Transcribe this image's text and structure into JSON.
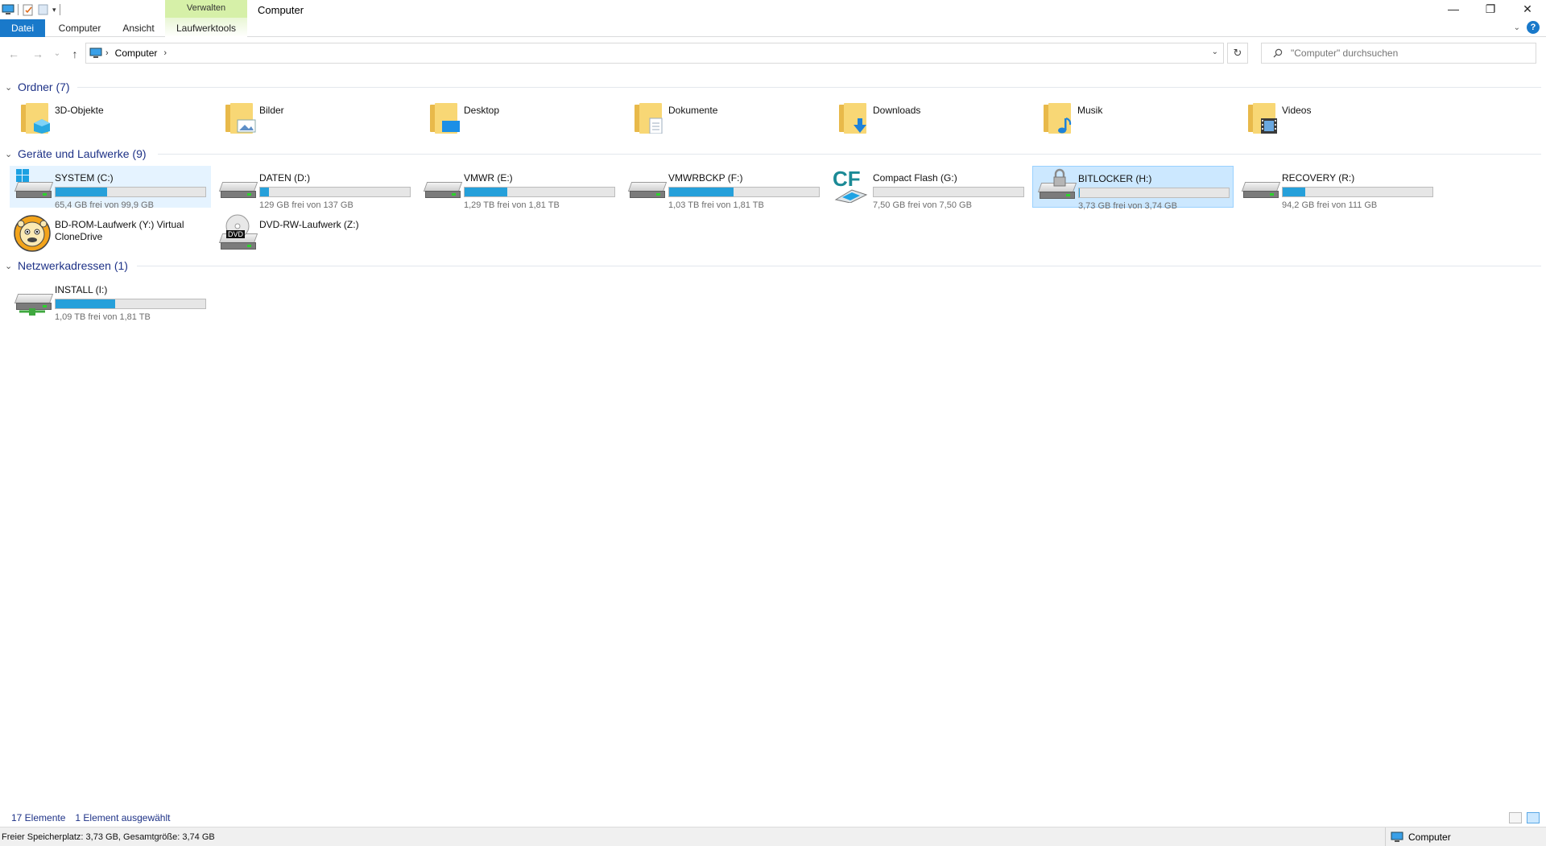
{
  "window": {
    "title": "Computer",
    "context_group": "Verwalten",
    "controls": {
      "minimize": "—",
      "maximize": "❐",
      "close": "✕"
    }
  },
  "ribbon": {
    "tabs": [
      "Datei",
      "Computer",
      "Ansicht"
    ],
    "context_tab": "Laufwerktools",
    "help": "?"
  },
  "nav": {
    "back": "←",
    "forward": "→",
    "recent": "⌄",
    "up": "↑",
    "breadcrumb": [
      "Computer"
    ],
    "search_placeholder": "\"Computer\" durchsuchen"
  },
  "groups": {
    "folders": {
      "label": "Ordner (7)"
    },
    "drives": {
      "label": "Geräte und Laufwerke (9)"
    },
    "network": {
      "label": "Netzwerkadressen (1)"
    }
  },
  "folders": [
    {
      "name": "3D-Objekte",
      "icon": "3d-objects-icon",
      "badge_color": "#29a8e0"
    },
    {
      "name": "Bilder",
      "icon": "pictures-icon",
      "badge_color": "#5e8fc7"
    },
    {
      "name": "Desktop",
      "icon": "desktop-icon",
      "badge_color": "#1c8fe6"
    },
    {
      "name": "Dokumente",
      "icon": "documents-icon",
      "badge_color": "#9dadbf"
    },
    {
      "name": "Downloads",
      "icon": "downloads-icon",
      "badge_color": "#1d82d9"
    },
    {
      "name": "Musik",
      "icon": "music-icon",
      "badge_color": "#1d82d9"
    },
    {
      "name": "Videos",
      "icon": "videos-icon",
      "badge_color": "#3a3a3a"
    }
  ],
  "drives": [
    {
      "name": "SYSTEM (C:)",
      "free": "65,4 GB frei von 99,9 GB",
      "used_fraction": 0.345,
      "icon": "windows-drive-icon"
    },
    {
      "name": "DATEN (D:)",
      "free": "129 GB frei von 137 GB",
      "used_fraction": 0.058,
      "icon": "hard-drive-icon"
    },
    {
      "name": "VMWR (E:)",
      "free": "1,29 TB frei von 1,81 TB",
      "used_fraction": 0.287,
      "icon": "hard-drive-icon"
    },
    {
      "name": "VMWRBCKP (F:)",
      "free": "1,03 TB frei von 1,81 TB",
      "used_fraction": 0.431,
      "icon": "hard-drive-icon"
    },
    {
      "name": "Compact Flash (G:)",
      "free": "7,50 GB frei von 7,50 GB",
      "used_fraction": 0.0,
      "icon": "compact-flash-icon"
    },
    {
      "name": "BITLOCKER (H:)",
      "free": "3,73 GB frei von 3,74 GB",
      "used_fraction": 0.003,
      "icon": "bitlocker-drive-icon"
    },
    {
      "name": "RECOVERY (R:)",
      "free": "94,2 GB frei von 111 GB",
      "used_fraction": 0.151,
      "icon": "hard-drive-icon"
    },
    {
      "name": "BD-ROM-Laufwerk (Y:) Virtual CloneDrive",
      "icon": "virtual-clonedrive-icon"
    },
    {
      "name": "DVD-RW-Laufwerk (Z:)",
      "icon": "dvd-drive-icon",
      "disc_label": "DVD"
    }
  ],
  "network": [
    {
      "name": "INSTALL (I:)",
      "free": "1,09 TB frei von 1,81 TB",
      "used_fraction": 0.398,
      "icon": "network-drive-icon"
    }
  ],
  "compact_flash_logo": "CF",
  "status": {
    "count": "17 Elemente",
    "selection": "1 Element ausgewählt",
    "details": "Freier Speicherplatz: 3,73 GB, Gesamtgröße: 3,74 GB",
    "location": "Computer"
  },
  "colors": {
    "accent": "#1979ca",
    "bar_fill": "#26a0da",
    "selection": "#cce8ff",
    "group_header": "#1e3287",
    "context_tab": "#d6f0a8"
  }
}
